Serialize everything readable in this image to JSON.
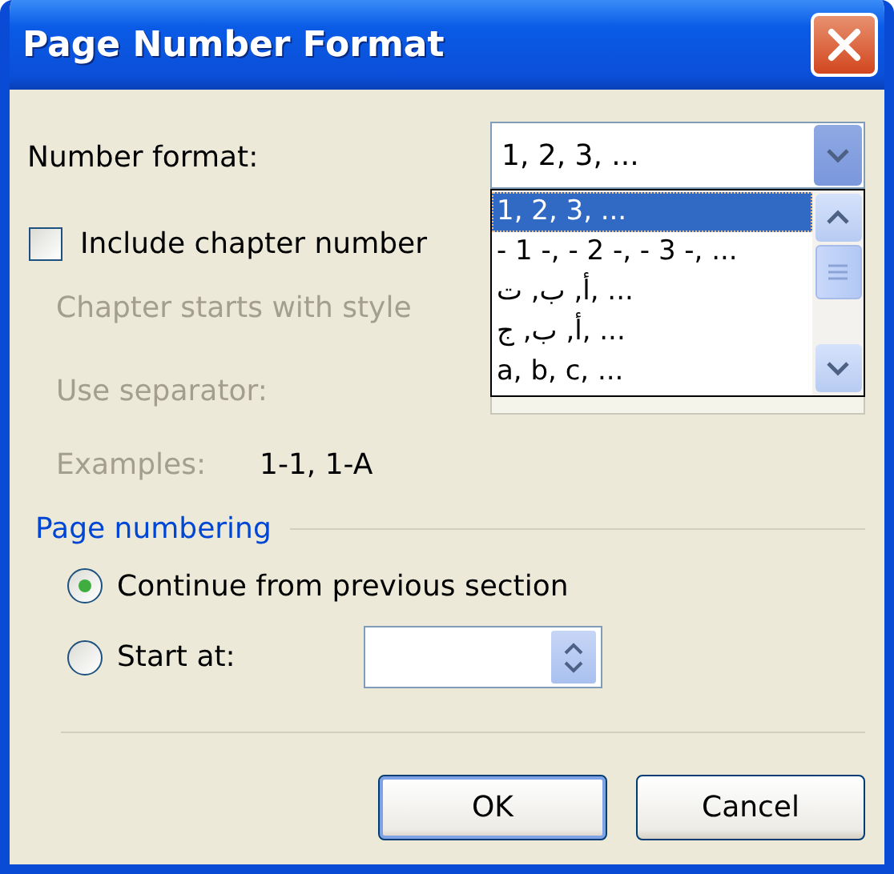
{
  "window": {
    "title": "Page Number Format"
  },
  "number_format": {
    "label": "Number format:",
    "value": "1, 2, 3, ...",
    "expanded": true,
    "options": [
      {
        "label": "1, 2, 3, ...",
        "selected": true
      },
      {
        "label": "- 1 -, - 2 -, - 3 -, ...",
        "selected": false
      },
      {
        "label": "أ, ب, ت, ...",
        "selected": false
      },
      {
        "label": "أ, ب, ج, ...",
        "selected": false
      },
      {
        "label": "a, b, c, ...",
        "selected": false
      }
    ]
  },
  "include_chapter": {
    "label": "Include chapter number",
    "checked": false
  },
  "chapter_style": {
    "label": "Chapter starts with style",
    "disabled": true
  },
  "separator": {
    "label": "Use separator:",
    "disabled": true
  },
  "examples": {
    "label": "Examples:",
    "value": "1-1, 1-A",
    "disabled": true
  },
  "page_numbering": {
    "title": "Page numbering",
    "options": [
      {
        "label": "Continue from previous section",
        "selected": true
      },
      {
        "label": "Start at:",
        "selected": false
      }
    ]
  },
  "buttons": [
    {
      "label": "OK",
      "default": true
    },
    {
      "label": "Cancel",
      "default": false
    }
  ]
}
